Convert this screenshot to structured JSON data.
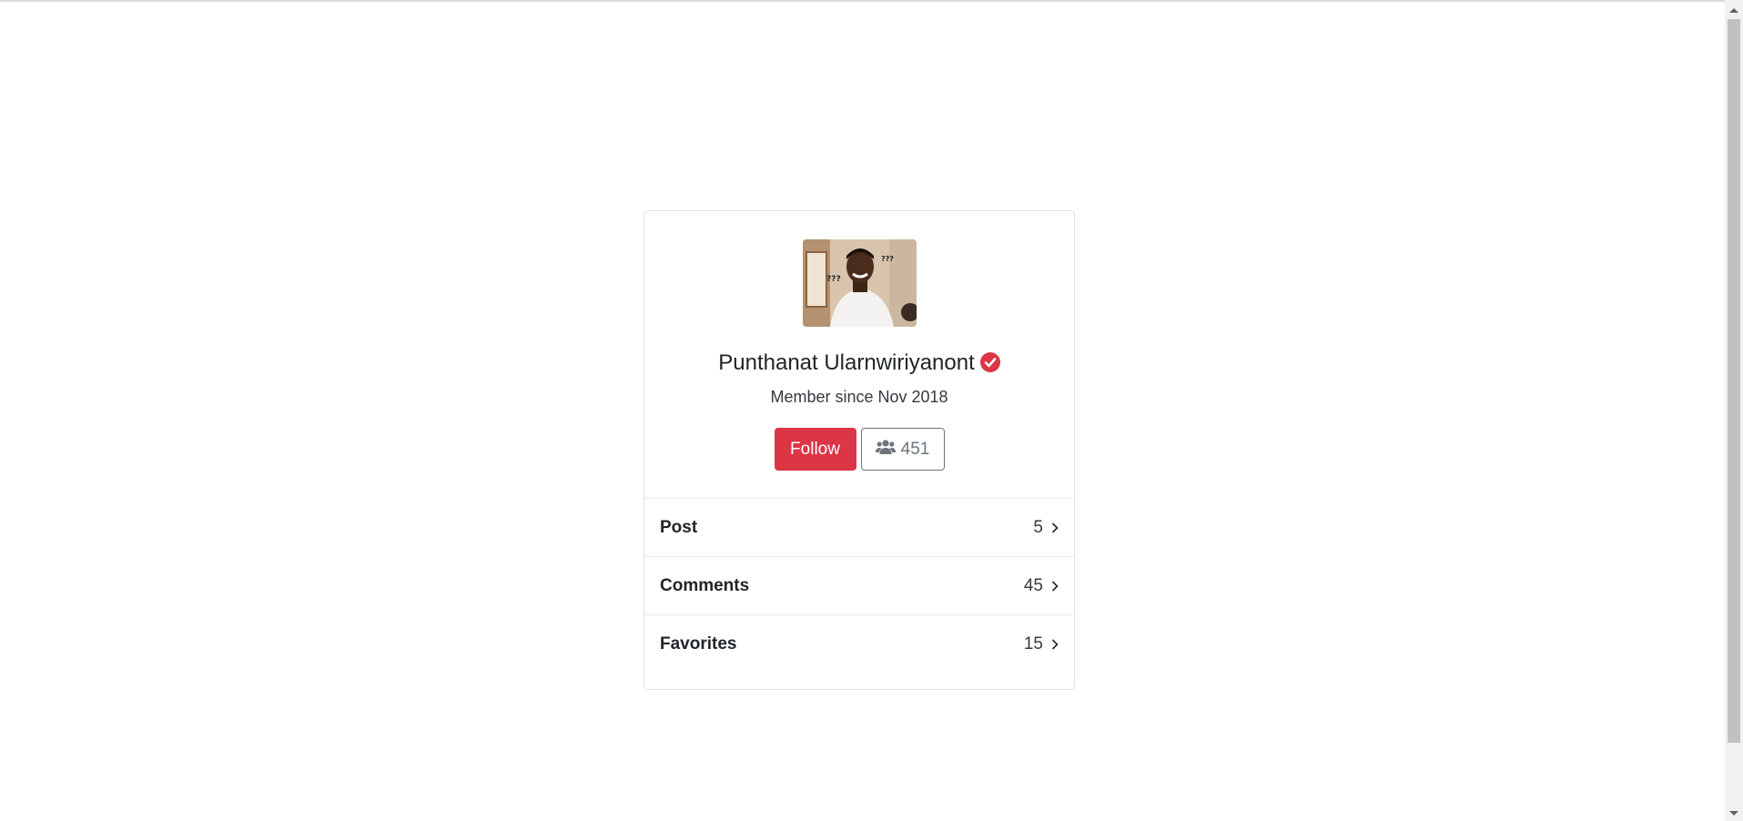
{
  "profile": {
    "name": "Punthanat Ularnwiriyanont",
    "member_since": "Member since Nov 2018",
    "avatar_alt": "Profile photo",
    "verified_icon": "verified-check-icon"
  },
  "actions": {
    "follow_label": "Follow",
    "followers_count": "451",
    "followers_icon": "users-icon"
  },
  "stats": [
    {
      "label": "Post",
      "count": "5"
    },
    {
      "label": "Comments",
      "count": "45"
    },
    {
      "label": "Favorites",
      "count": "15"
    }
  ],
  "colors": {
    "accent": "#dc3545",
    "secondary": "#6c757d"
  }
}
